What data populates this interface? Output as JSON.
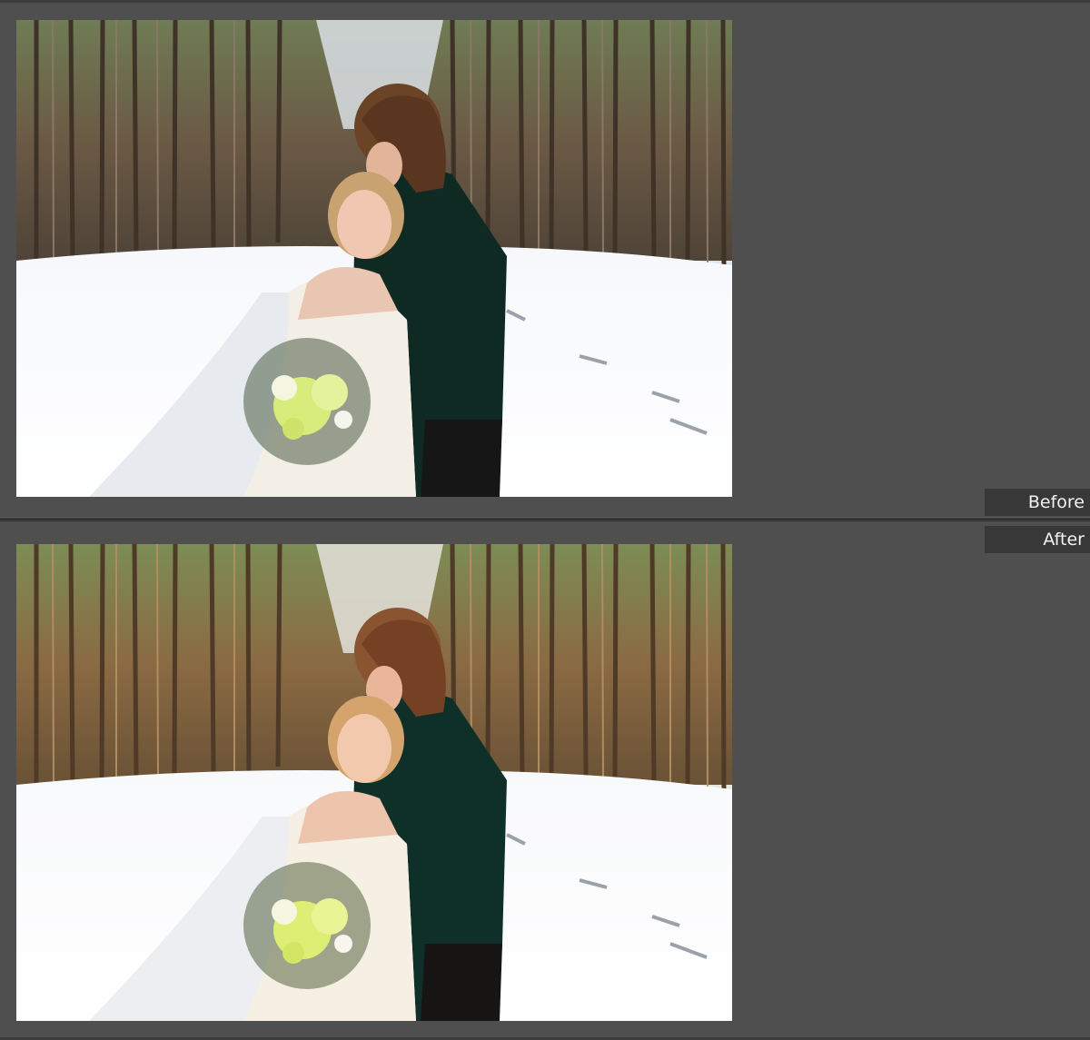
{
  "labels": {
    "before": "Before",
    "after": "After"
  },
  "colors": {
    "background": "#4f4f4f",
    "label_background": "#383838",
    "label_text": "#f2f2f2",
    "divider": "#151515"
  },
  "photos": {
    "before": {
      "tone": "neutral"
    },
    "after": {
      "tone": "warm"
    }
  }
}
